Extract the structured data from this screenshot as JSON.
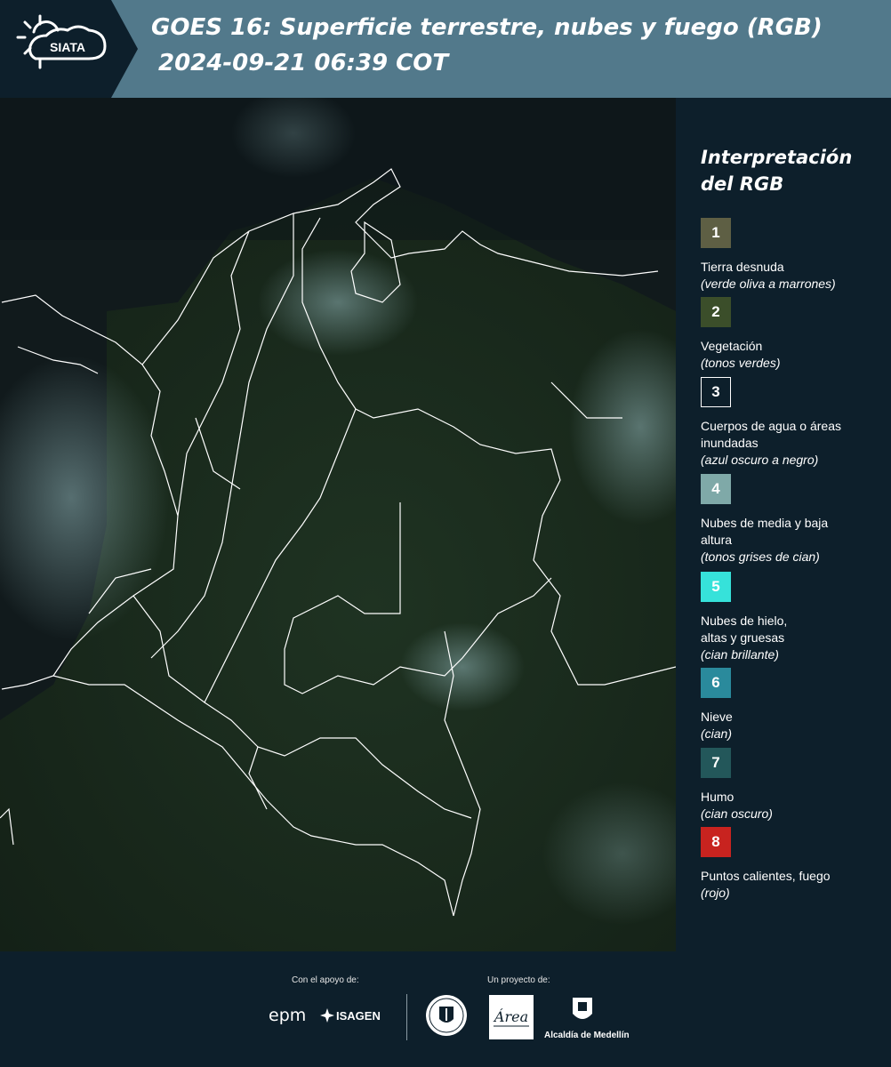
{
  "header": {
    "logo_text": "SIATA",
    "title_line1": "GOES 16: Superficie terrestre, nubes y fuego (RGB)",
    "title_line2": "2024-09-21 06:39 COT"
  },
  "legend": {
    "title_line1": "Interpretación",
    "title_line2": "del RGB",
    "items": [
      {
        "num": "1",
        "color": "#5e5f44",
        "label": "Tierra desnuda",
        "sub": "(verde oliva a marrones)"
      },
      {
        "num": "2",
        "color": "#3b4e2a",
        "label": "Vegetación",
        "sub": "(tonos verdes)"
      },
      {
        "num": "3",
        "color": "#0d1f2b",
        "label": "Cuerpos de agua o áreas inundadas",
        "sub": "(azul oscuro a negro)"
      },
      {
        "num": "4",
        "color": "#7fa9a8",
        "label": "Nubes de media y baja altura",
        "sub": "(tonos grises de cian)"
      },
      {
        "num": "5",
        "color": "#36e2da",
        "label": "Nubes de hielo, altas y gruesas",
        "sub": "(cian brillante)"
      },
      {
        "num": "6",
        "color": "#2a8a9c",
        "label": "Nieve",
        "sub": "(cian)"
      },
      {
        "num": "7",
        "color": "#23575a",
        "label": "Humo",
        "sub": "(cian oscuro)"
      },
      {
        "num": "8",
        "color": "#c8231f",
        "label": "Puntos calientes, fuego",
        "sub": "(rojo)"
      }
    ]
  },
  "footer": {
    "support_label": "Con el apoyo de:",
    "project_label": "Un proyecto de:",
    "sponsors": [
      "epm",
      "ISAGEN"
    ],
    "partners": [
      "Área Metropolitana",
      "Alcaldía de Medellín"
    ]
  }
}
